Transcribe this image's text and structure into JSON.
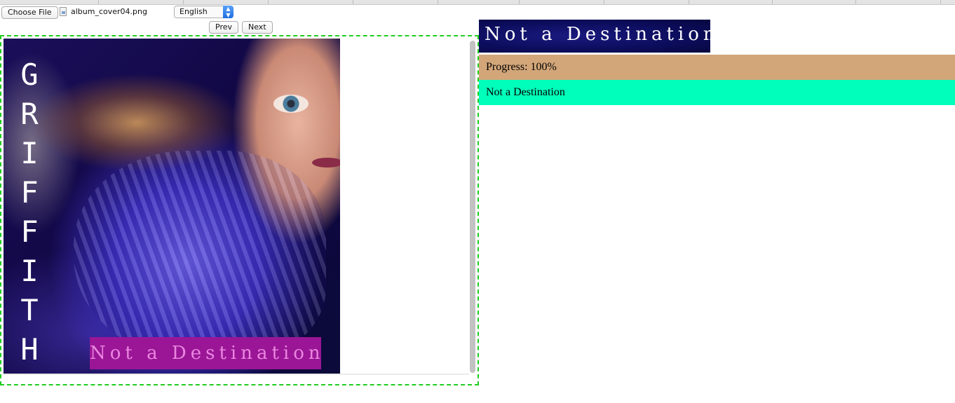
{
  "toolbar": {
    "choose_file_label": "Choose File",
    "file_name": "album_cover04.png",
    "language": "English",
    "prev_label": "Prev",
    "next_label": "Next"
  },
  "cover": {
    "artist_vertical": "GRIFFITH",
    "title": "Not a Destination"
  },
  "panel": {
    "title": "Not a Destination",
    "progress_text": "Progress: 100%",
    "progress_value": 100,
    "track_name": "Not a Destination"
  },
  "colors": {
    "viewer_border": "#22cc22",
    "progress_bg": "#d2a679",
    "track_bg": "#00ffbb",
    "banner_bg": "#0c0c5c",
    "cover_label_bg": "#9a1696",
    "select_accent": "#1d6fe2"
  },
  "icons": {
    "file": "file-icon",
    "select_arrows": "updown-chevron-icon"
  }
}
